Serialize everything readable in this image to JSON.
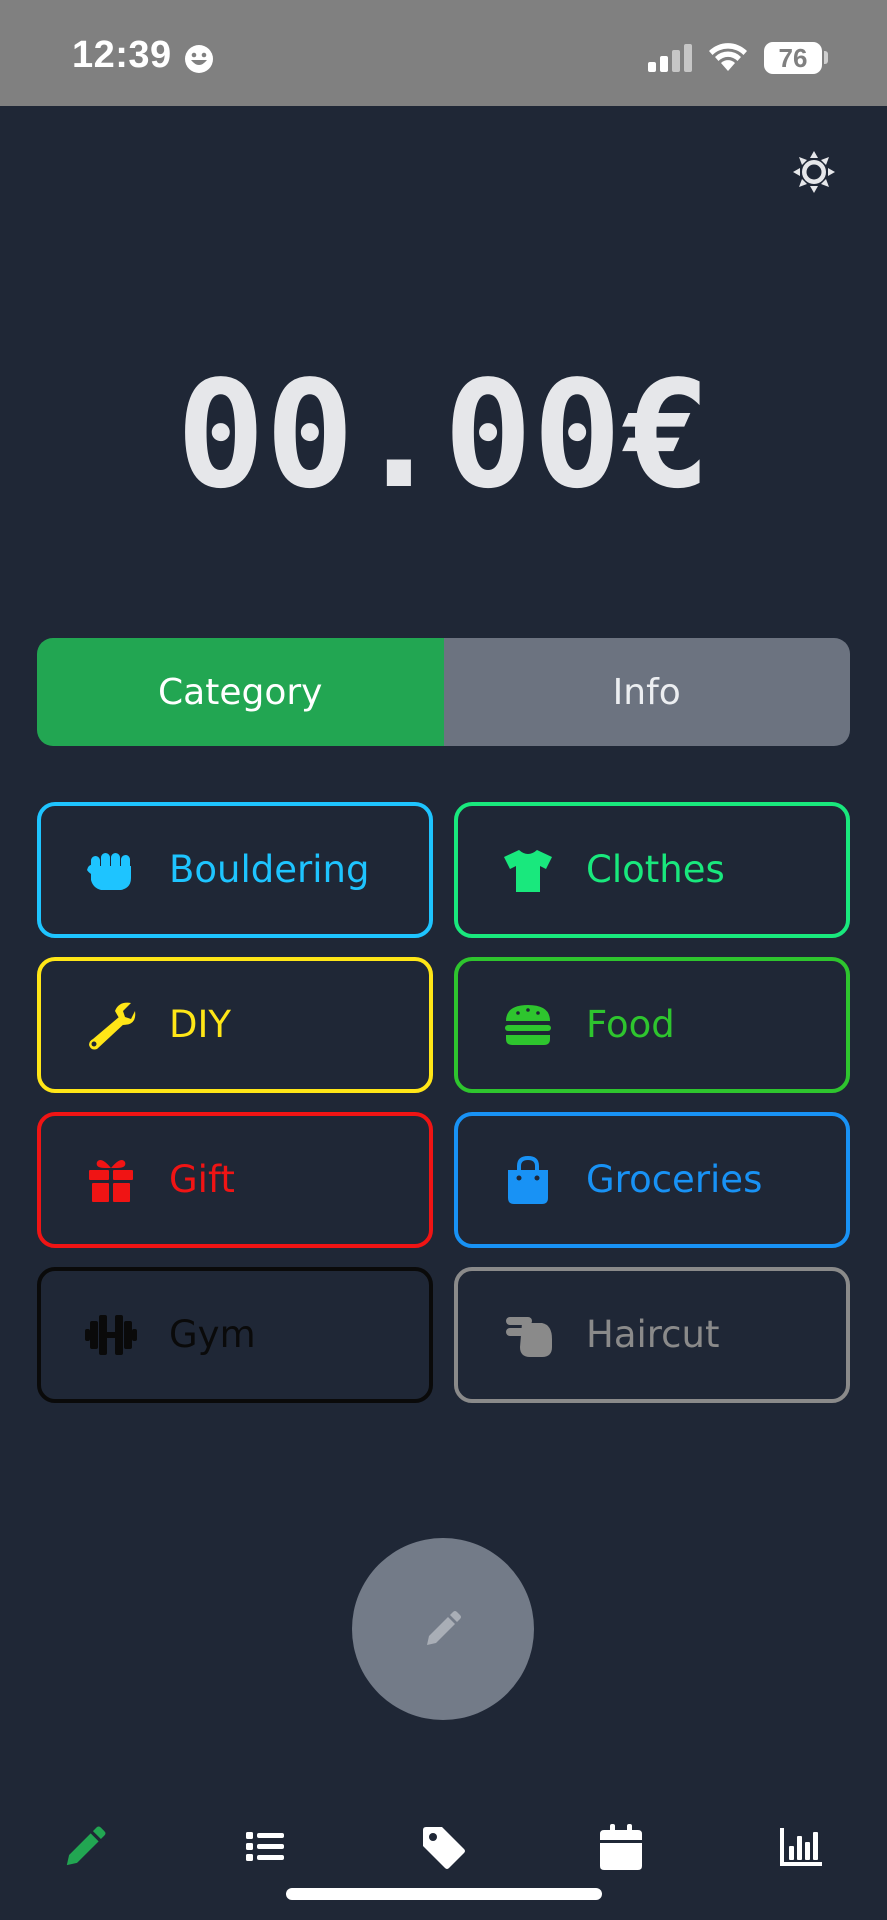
{
  "status_bar": {
    "time": "12:39",
    "battery": "76"
  },
  "amount": {
    "value": "00.00€"
  },
  "segmented": {
    "category_label": "Category",
    "info_label": "Info",
    "active": "Category",
    "active_color": "#22a652"
  },
  "categories": [
    {
      "label": "Bouldering",
      "color": "#1ec4ff",
      "icon": "fist-icon"
    },
    {
      "label": "Clothes",
      "color": "#19e87d",
      "icon": "shirt-icon"
    },
    {
      "label": "DIY",
      "color": "#ffe617",
      "icon": "wrench-icon"
    },
    {
      "label": "Food",
      "color": "#2ec52e",
      "icon": "burger-icon"
    },
    {
      "label": "Gift",
      "color": "#f01414",
      "icon": "gift-icon"
    },
    {
      "label": "Groceries",
      "color": "#1892f5",
      "icon": "shopping-bag-icon"
    },
    {
      "label": "Gym",
      "color": "#0a0a0a",
      "icon": "dumbbell-icon"
    },
    {
      "label": "Haircut",
      "color": "#8a8a8a",
      "icon": "scissors-hand-icon"
    }
  ],
  "bottom_nav": {
    "items": [
      "edit-icon",
      "list-icon",
      "tag-icon",
      "calendar-icon",
      "chart-icon"
    ],
    "active": "edit-icon",
    "active_color": "#22a652",
    "inactive_color": "#ffffff"
  }
}
